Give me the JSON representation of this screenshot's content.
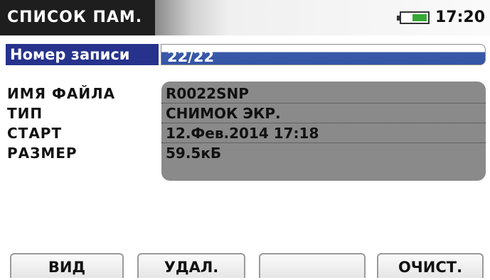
{
  "header": {
    "title": "СПИСОК ПАМ.",
    "battery_icon": "battery-icon",
    "battery_level": 0.6,
    "battery_color": "#36a836",
    "time": "17:20"
  },
  "record": {
    "label": "Номер записи",
    "value": "22/22"
  },
  "info": {
    "labels": [
      "ИМЯ ФАЙЛА",
      "ТИП",
      "СТАРТ",
      "РАЗМЕР"
    ],
    "values": [
      "R0022SNP",
      "СНИМОК ЭКР.",
      "12.Фев.2014 17:18",
      "59.5кБ"
    ]
  },
  "softkeys": [
    "ВИД",
    "УДАЛ.",
    "",
    "ОЧИСТ."
  ],
  "colors": {
    "title_bg": "#1e1e1e",
    "record_label_bg": "#26328c",
    "record_value_bg": "#3454a6",
    "panel_bg": "#8a8a8a"
  }
}
